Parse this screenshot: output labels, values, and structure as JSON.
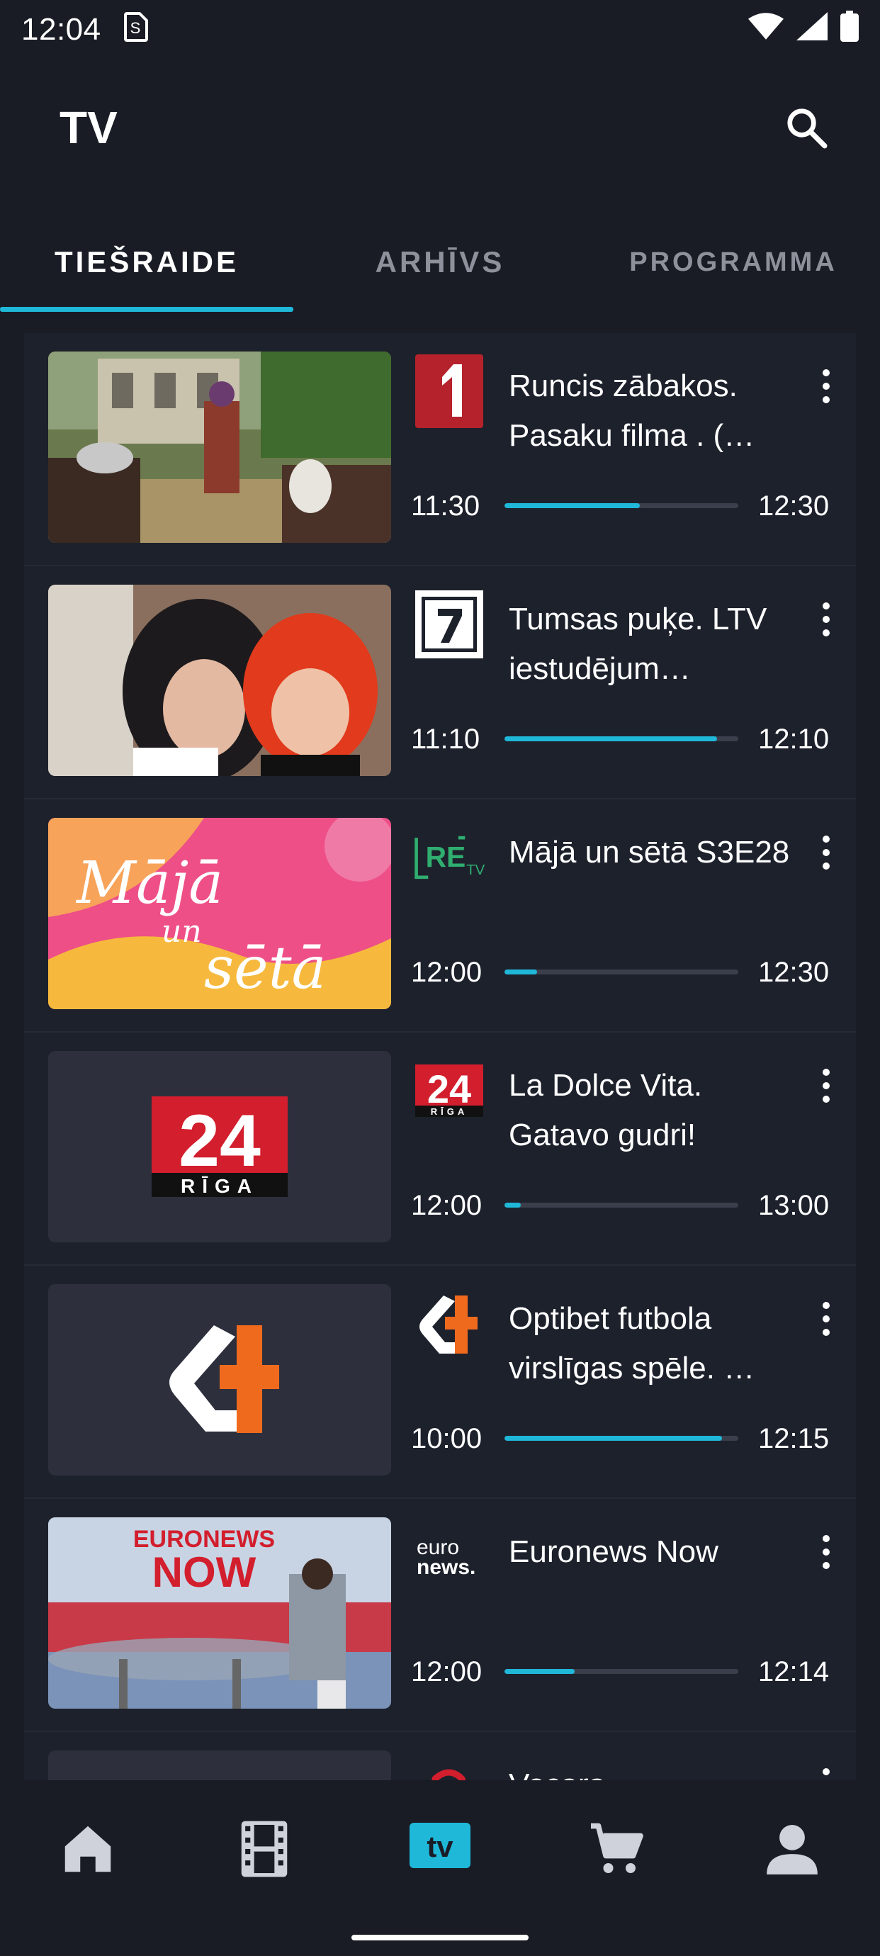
{
  "status_bar": {
    "time": "12:04",
    "sim_icon": "sim-card-icon"
  },
  "app_bar": {
    "title": "TV",
    "search_icon": "search-icon"
  },
  "tabs": [
    {
      "label": "TIEŠRAIDE",
      "active": true
    },
    {
      "label": "ARHĪVS",
      "active": false
    },
    {
      "label": "PROGRAMMA",
      "active": false
    }
  ],
  "accent_color": "#1fb8d9",
  "programs": [
    {
      "channel_logo": "ltv1-logo",
      "title": "Runcis zābakos. Pasaku filma . (…",
      "start": "11:30",
      "end": "12:30",
      "progress": 0.58
    },
    {
      "channel_logo": "ltv7-logo",
      "title": "Tumsas puķe. LTV iestudējum…",
      "start": "11:10",
      "end": "12:10",
      "progress": 0.91
    },
    {
      "channel_logo": "retv-logo",
      "title": "Mājā un sētā S3E28",
      "start": "12:00",
      "end": "12:30",
      "progress": 0.14
    },
    {
      "channel_logo": "riga24-logo",
      "title": "La Dolce Vita. Gatavo gudri!",
      "start": "12:00",
      "end": "13:00",
      "progress": 0.07
    },
    {
      "channel_logo": "tv4-logo",
      "title": "Optibet futbola virslīgas spēle. …",
      "start": "10:00",
      "end": "12:15",
      "progress": 0.93
    },
    {
      "channel_logo": "euronews-logo",
      "title": "Euronews Now",
      "start": "12:00",
      "end": "12:14",
      "progress": 0.3
    },
    {
      "channel_logo": "channel3-logo",
      "title": "Vecara",
      "start": "",
      "end": "",
      "progress": 0
    }
  ],
  "thumb_texts": {
    "maja_line1": "Mājā",
    "maja_line2": "un",
    "maja_line3": "sētā",
    "riga24_num": "24",
    "riga24_city": "RĪGA",
    "euronews_top": "EURONEWS",
    "euronews_bottom": "NOW",
    "retv_text": "RE",
    "retv_small": "TV",
    "euro_logo_top": "euro",
    "euro_logo_bottom": "news."
  },
  "bottom_nav": [
    {
      "icon": "home-icon",
      "active": false
    },
    {
      "icon": "film-icon",
      "active": false
    },
    {
      "icon": "tv-icon",
      "label": "tv",
      "active": true
    },
    {
      "icon": "cart-icon",
      "active": false
    },
    {
      "icon": "profile-icon",
      "active": false
    }
  ]
}
